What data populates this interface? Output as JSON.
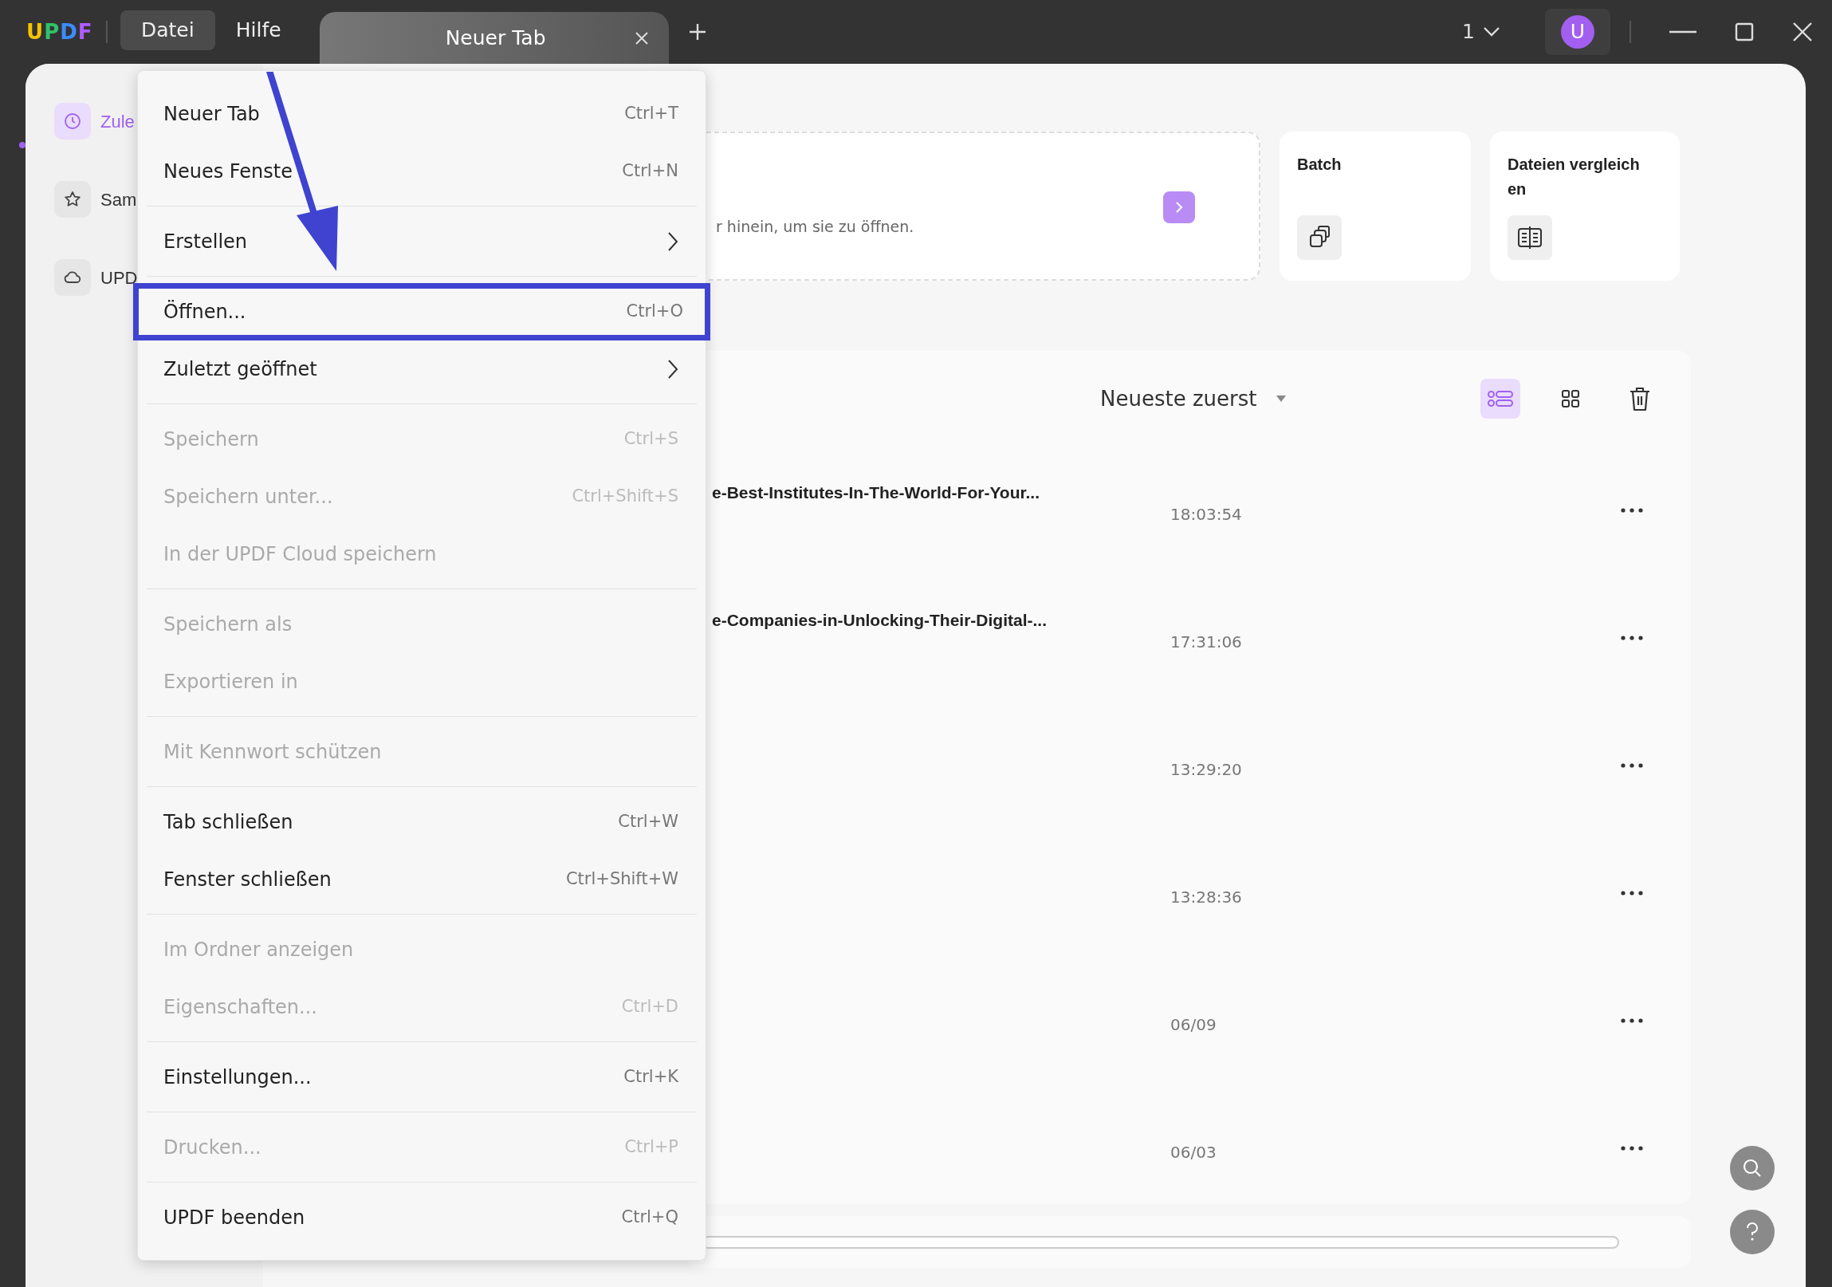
{
  "app": {
    "logo": "UPDF"
  },
  "menubar": [
    {
      "label": "Datei",
      "selected": true
    },
    {
      "label": "Hilfe",
      "selected": false
    }
  ],
  "tabs": [
    {
      "label": "Neuer Tab",
      "selected": true
    }
  ],
  "window_count": "1",
  "avatar": "U",
  "sidebar": {
    "items": [
      {
        "label": "Zule",
        "selected": true
      },
      {
        "label": "Sam",
        "selected": false
      },
      {
        "label": "UPD",
        "selected": false
      }
    ]
  },
  "drop_zone": {
    "text": "r hinein, um sie zu öffnen."
  },
  "tools": [
    {
      "title": "Batch"
    },
    {
      "title": "Dateien vergleich\nen"
    }
  ],
  "sort": {
    "label": "Neueste zuerst"
  },
  "view_modes": [
    {
      "kind": "list",
      "selected": true
    },
    {
      "kind": "grid",
      "selected": false
    }
  ],
  "files": [
    {
      "name": "e-Best-Institutes-In-The-World-For-Your...",
      "time": "18:03:54"
    },
    {
      "name": "e-Companies-in-Unlocking-Their-Digital-...",
      "time": "17:31:06"
    },
    {
      "time": "13:29:20"
    },
    {
      "time": "13:28:36"
    },
    {
      "time": "06/09"
    },
    {
      "time": "06/03"
    }
  ],
  "menu": {
    "groups": [
      [
        {
          "label": "Neuer Tab",
          "shortcut": "Ctrl+T",
          "disabled": false,
          "highlighted": false
        },
        {
          "label": "Neues Fenste",
          "shortcut": "Ctrl+N",
          "disabled": false,
          "highlighted": false
        }
      ],
      [
        {
          "label": "Erstellen",
          "kind": "submenu",
          "disabled": false,
          "highlighted": false
        }
      ],
      [
        {
          "label": "Öffnen...",
          "shortcut": "Ctrl+O",
          "disabled": false,
          "highlighted": true
        },
        {
          "label": "Zuletzt geöffnet",
          "kind": "submenu",
          "disabled": false,
          "highlighted": false
        }
      ],
      [
        {
          "label": "Speichern",
          "shortcut": "Ctrl+S",
          "disabled": true,
          "highlighted": false
        },
        {
          "label": "Speichern unter...",
          "shortcut": "Ctrl+Shift+S",
          "disabled": true,
          "highlighted": false
        },
        {
          "label": "In der UPDF Cloud speichern",
          "disabled": true,
          "highlighted": false
        }
      ],
      [
        {
          "label": "Speichern als",
          "disabled": true,
          "highlighted": false
        },
        {
          "label": "Exportieren in",
          "disabled": true,
          "highlighted": false
        }
      ],
      [
        {
          "label": "Mit Kennwort schützen",
          "disabled": true,
          "highlighted": false
        }
      ],
      [
        {
          "label": "Tab schließen",
          "shortcut": "Ctrl+W",
          "disabled": false,
          "highlighted": false
        },
        {
          "label": "Fenster schließen",
          "shortcut": "Ctrl+Shift+W",
          "disabled": false,
          "highlighted": false
        }
      ],
      [
        {
          "label": "Im Ordner anzeigen",
          "disabled": true,
          "highlighted": false
        },
        {
          "label": "Eigenschaften...",
          "shortcut": "Ctrl+D",
          "disabled": true,
          "highlighted": false
        }
      ],
      [
        {
          "label": "Einstellungen...",
          "shortcut": "Ctrl+K",
          "disabled": false,
          "highlighted": false
        }
      ],
      [
        {
          "label": "Drucken...",
          "shortcut": "Ctrl+P",
          "disabled": true,
          "highlighted": false
        }
      ],
      [
        {
          "label": "UPDF beenden",
          "shortcut": "Ctrl+Q",
          "disabled": false,
          "highlighted": false
        }
      ]
    ]
  }
}
